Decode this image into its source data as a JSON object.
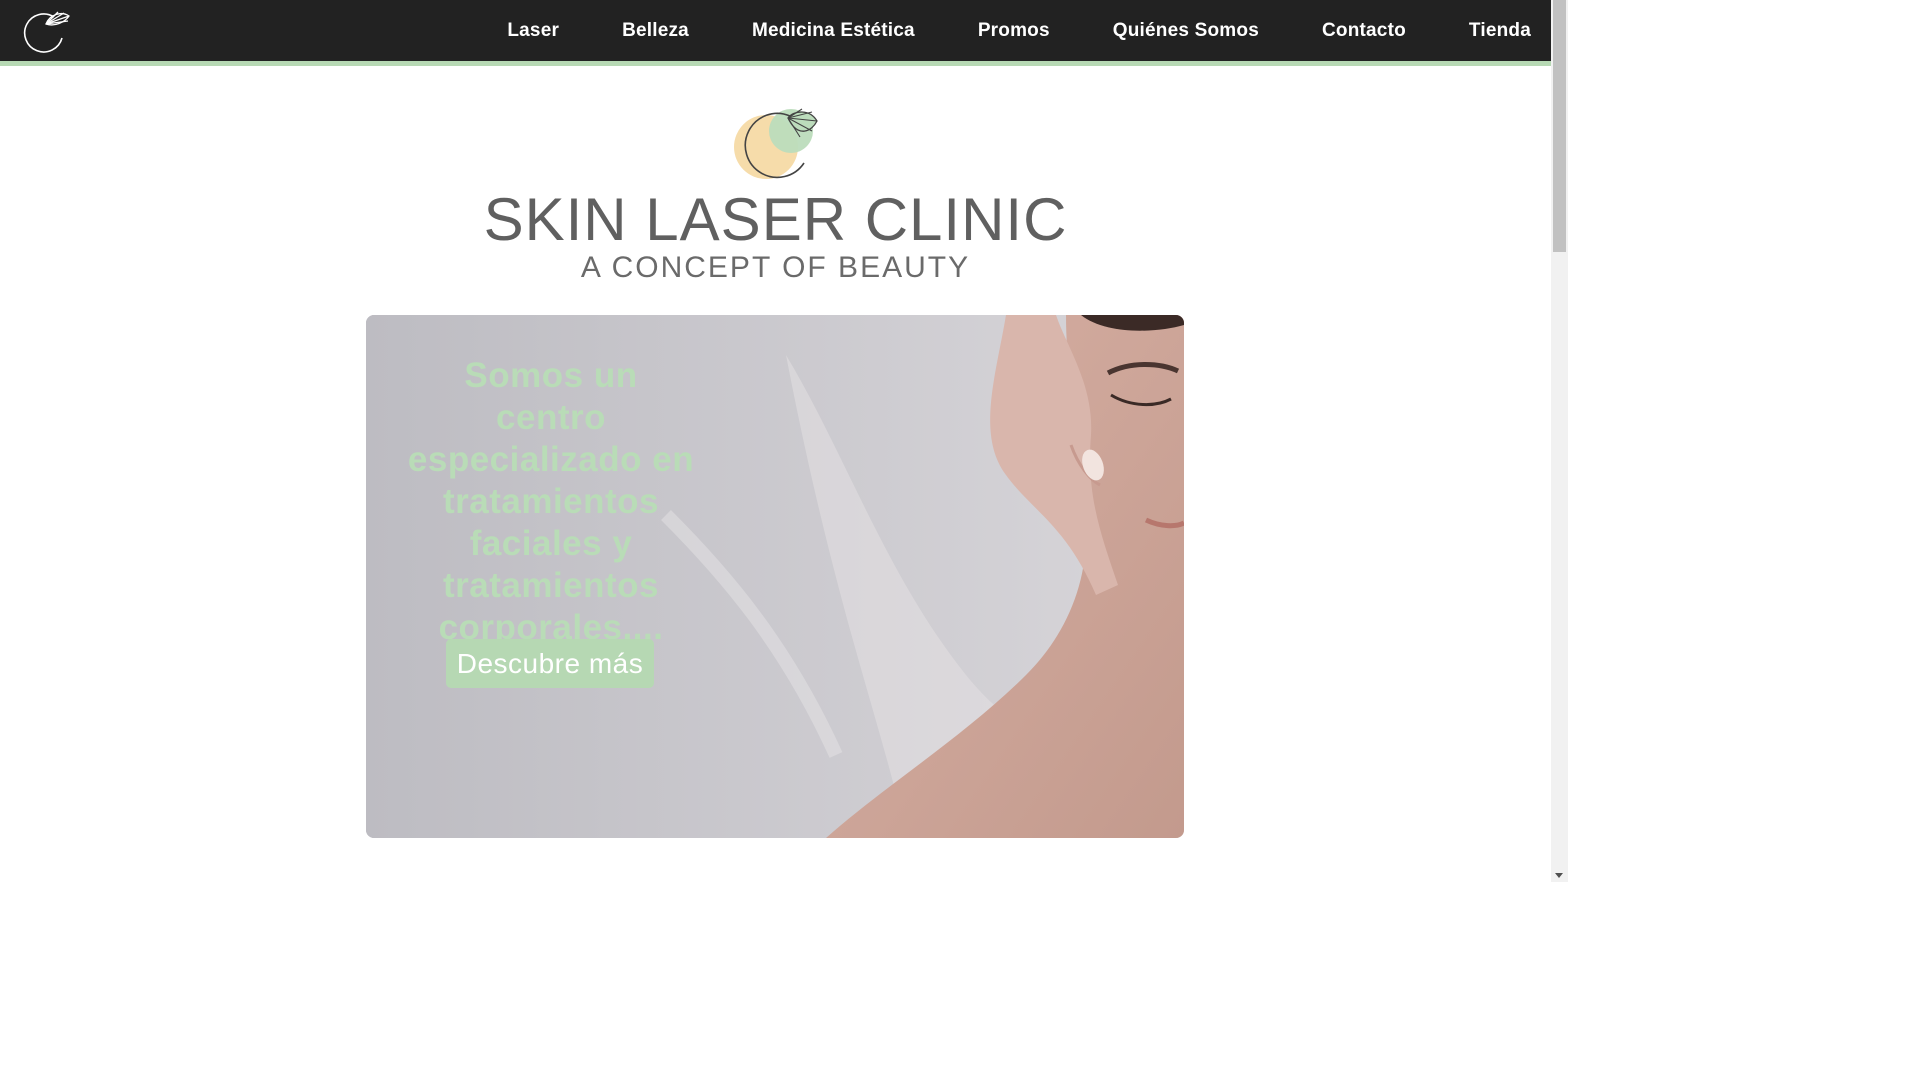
{
  "nav": {
    "logo_icon": "clinic-logo-icon",
    "items": [
      {
        "label": "Laser"
      },
      {
        "label": "Belleza"
      },
      {
        "label": "Medicina Estética"
      },
      {
        "label": "Promos"
      },
      {
        "label": "Quiénes Somos"
      },
      {
        "label": "Contacto"
      },
      {
        "label": "Tienda"
      }
    ],
    "background_color": "#222222",
    "accent_color": "#b7d9b4"
  },
  "brand": {
    "logo_icon": "clinic-logo-icon",
    "title": "SKIN LASER CLINIC",
    "tagline": "A CONCEPT OF BEAUTY",
    "logo_colors": {
      "peach": "#f6dcaa",
      "green": "#bcdcbc"
    }
  },
  "hero": {
    "headline": "Somos un centro especializado en tratamientos faciales y tratamientos corporales....",
    "button_label": "Descubre más",
    "text_color": "#b9dcb7",
    "button_color": "#b6d8b3"
  }
}
